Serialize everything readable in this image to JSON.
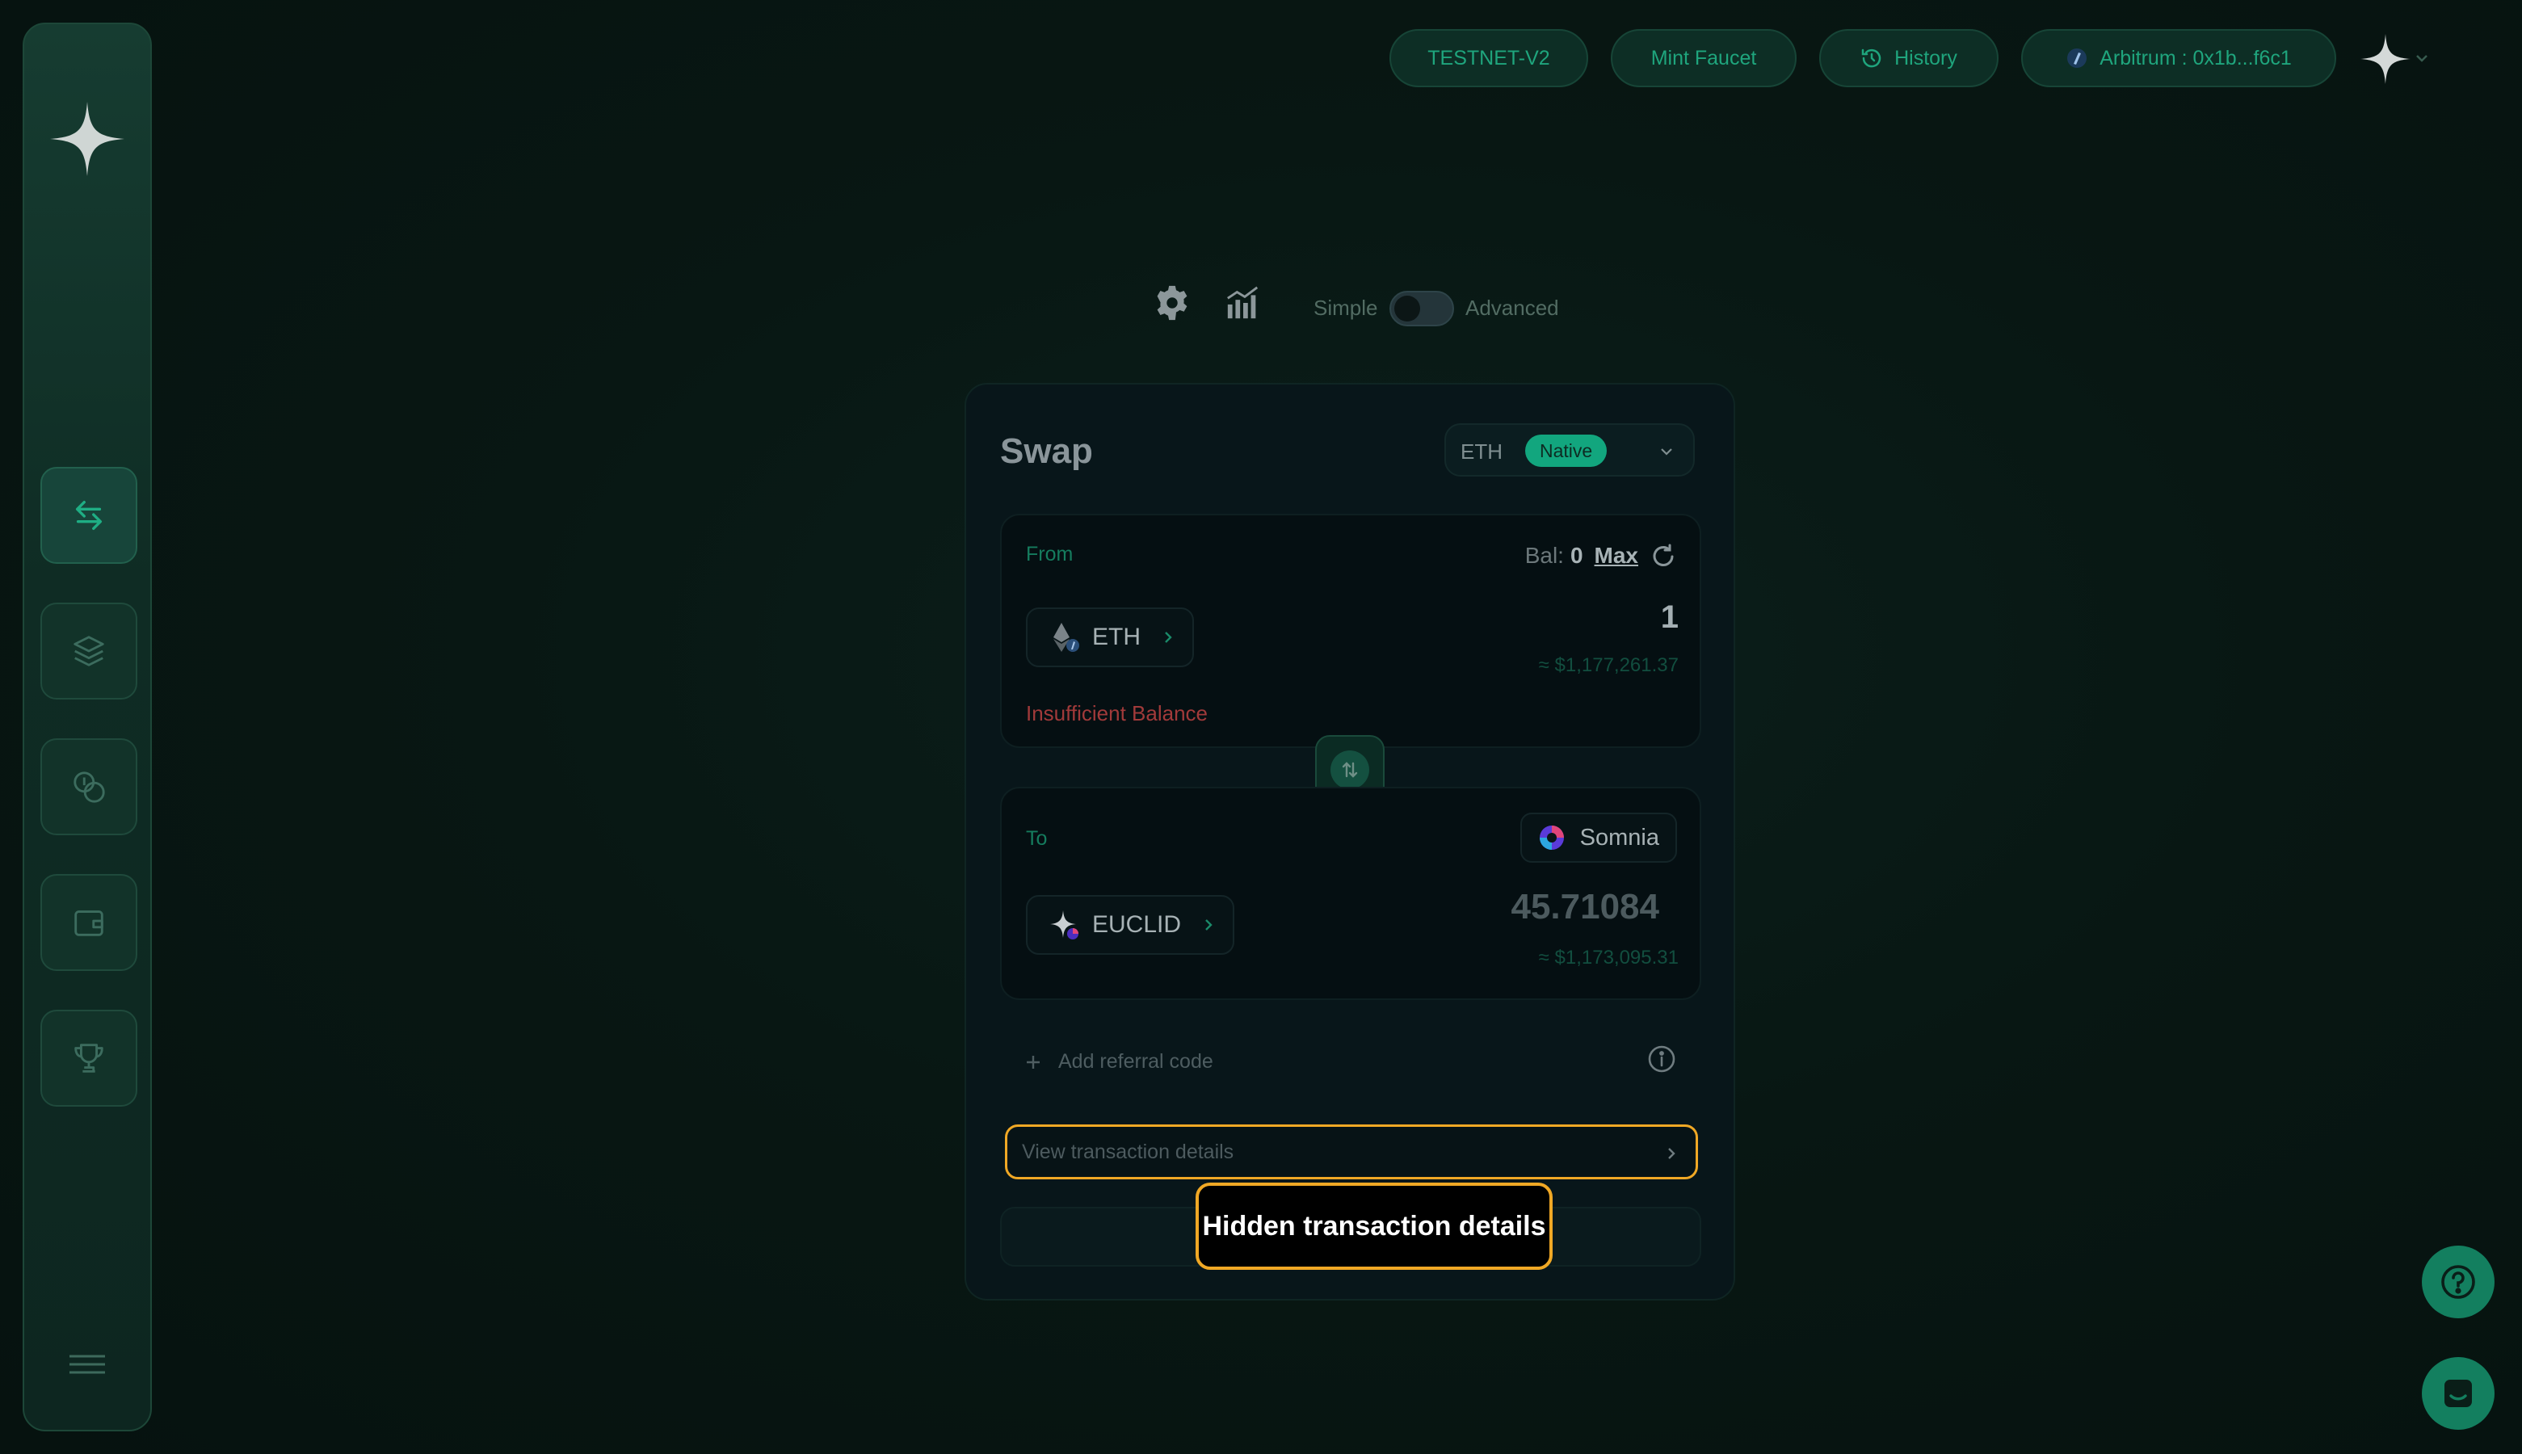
{
  "topbar": {
    "network_env": "TESTNET-V2",
    "faucet": "Mint Faucet",
    "history": "History",
    "wallet": "Arbitrum : 0x1b...f6c1"
  },
  "controls": {
    "mode_simple": "Simple",
    "mode_advanced": "Advanced",
    "advanced_enabled": false
  },
  "swap": {
    "title": "Swap",
    "network": {
      "token": "ETH",
      "badge": "Native"
    },
    "from": {
      "label": "From",
      "balance_label": "Bal:",
      "balance_value": "0",
      "max_label": "Max",
      "token": "ETH",
      "amount": "1",
      "usd": "≈ $1,177,261.37",
      "error": "Insufficient Balance"
    },
    "to": {
      "label": "To",
      "chain": "Somnia",
      "token": "EUCLID",
      "amount": "45.71084",
      "usd": "≈ $1,173,095.31"
    },
    "referral_label": "Add referral code",
    "view_details_label": "View transaction details",
    "tooltip": "Hidden transaction details"
  },
  "colors": {
    "accent": "#1fa57d",
    "highlight": "#f0a825",
    "error": "#a13a3a"
  }
}
